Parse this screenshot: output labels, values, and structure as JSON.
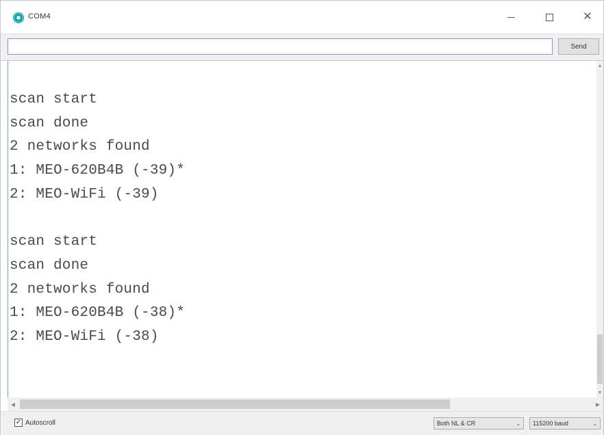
{
  "window": {
    "title": "COM4",
    "accent": "#00979c"
  },
  "send_bar": {
    "input_value": "",
    "send_label": "Send"
  },
  "output": {
    "lines": [
      "scan start",
      "scan done",
      "2 networks found",
      "1: MEO-620B4B (-39)*",
      "2: MEO-WiFi (-39)",
      "",
      "scan start",
      "scan done",
      "2 networks found",
      "1: MEO-620B4B (-38)*",
      "2: MEO-WiFi (-38)"
    ]
  },
  "status_bar": {
    "autoscroll_label": "Autoscroll",
    "autoscroll_checked": true,
    "line_ending": "Both NL & CR",
    "baud_rate": "115200 baud"
  },
  "icons": {
    "app": "arduino-icon",
    "minimize": "minimize-icon",
    "maximize": "maximize-icon",
    "close": "close-icon"
  }
}
